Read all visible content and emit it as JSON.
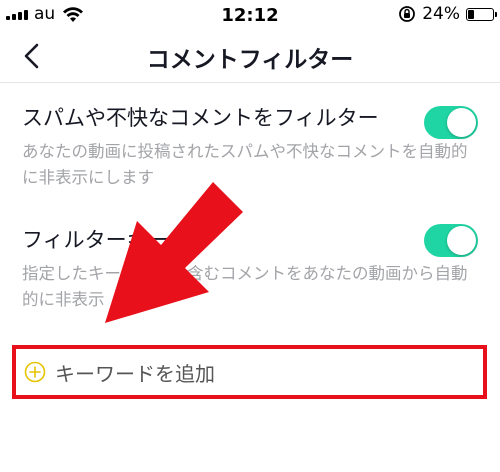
{
  "status_bar": {
    "carrier": "au",
    "time": "12:12",
    "battery_percent": "24%",
    "battery_level": 0.24
  },
  "nav": {
    "title": "コメントフィルター",
    "back_icon": "chevron-left-icon"
  },
  "settings": [
    {
      "title": "スパムや不快なコメントをフィルター",
      "description": "あなたの動画に投稿されたスパムや不快なコメントを自動的に非表示にします",
      "enabled": true
    },
    {
      "title": "フィルターキーワ",
      "description": "指定したキー　　　　含むコメントをあなたの動画から自動的に非表示",
      "enabled": true
    }
  ],
  "add_keyword": {
    "label": "キーワードを追加",
    "icon": "plus-circle-icon"
  },
  "colors": {
    "toggle_on": "#20d5a4",
    "annotation_red": "#e8101a",
    "plus_icon": "#e5c400"
  }
}
